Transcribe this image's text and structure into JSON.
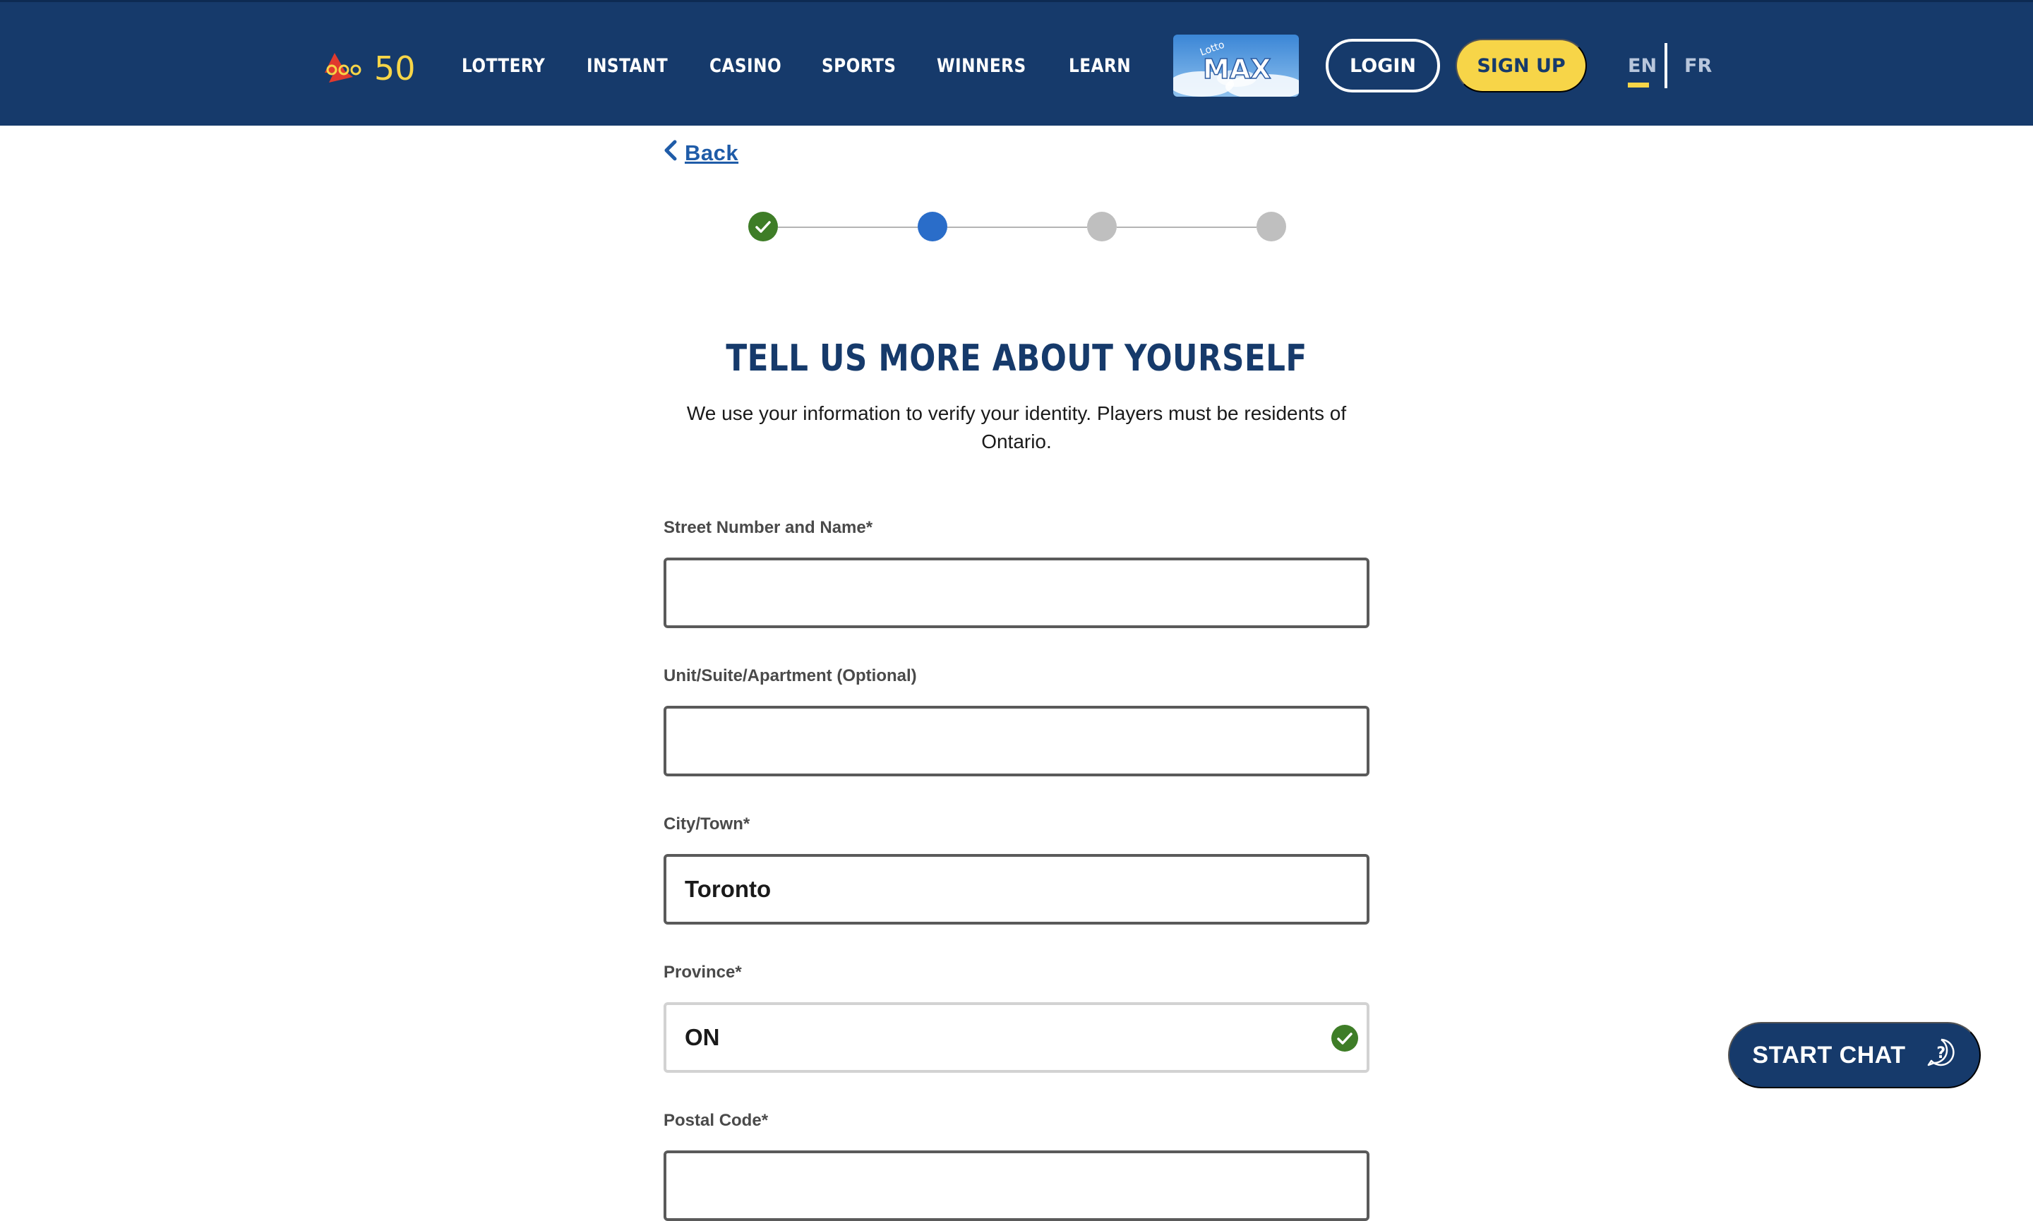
{
  "header": {
    "logo_text": "50",
    "nav": [
      "LOTTERY",
      "INSTANT",
      "CASINO",
      "SPORTS",
      "WINNERS",
      "LEARN"
    ],
    "promo_logo_text": "MAX",
    "promo_logo_small": "Lotto",
    "login_label": "LOGIN",
    "signup_label": "SIGN UP",
    "lang_en": "EN",
    "lang_fr": "FR",
    "active_lang": "EN"
  },
  "back_label": "Back",
  "stepper": {
    "total_steps": 4,
    "current_step": 2,
    "completed_steps": 1
  },
  "form": {
    "title": "TELL US MORE ABOUT YOURSELF",
    "subtitle": "We use your information to verify your identity. Players must be residents of Ontario.",
    "street_label": "Street Number and Name*",
    "street_value": "",
    "unit_label": "Unit/Suite/Apartment (Optional)",
    "unit_value": "",
    "city_label": "City/Town*",
    "city_value": "Toronto",
    "province_label": "Province*",
    "province_value": "ON",
    "postal_label": "Postal Code*"
  },
  "chat_label": "START CHAT",
  "colors": {
    "header_bg": "#163a6b",
    "accent_yellow": "#f7d548",
    "step_done": "#3e7d27",
    "step_active": "#2a6dc9",
    "step_todo": "#bfbfbf",
    "link_blue": "#1f5ca8"
  }
}
